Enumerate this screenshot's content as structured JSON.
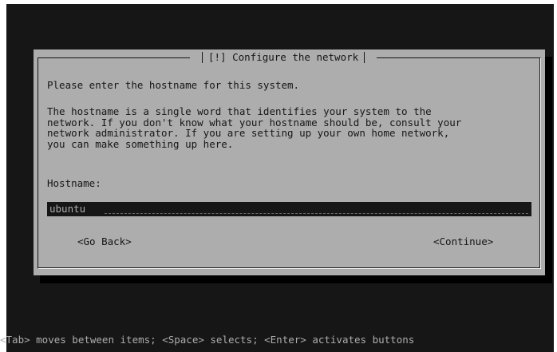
{
  "dialog": {
    "title": "[!] Configure the network",
    "prompt": "Please enter the hostname for this system.",
    "description": "The hostname is a single word that identifies your system to the\nnetwork. If you don't know what your hostname should be, consult your\nnetwork administrator. If you are setting up your own home network,\nyou can make something up here.",
    "field_label": "Hostname:",
    "field_value": "ubuntu",
    "back_button": "<Go Back>",
    "continue_button": "<Continue>"
  },
  "help_line": "<Tab> moves between items; <Space> selects; <Enter> activates buttons",
  "colors": {
    "screen_bg": "#161616",
    "dialog_bg": "#adadad",
    "text": "#161616",
    "shadow": "#000000"
  }
}
